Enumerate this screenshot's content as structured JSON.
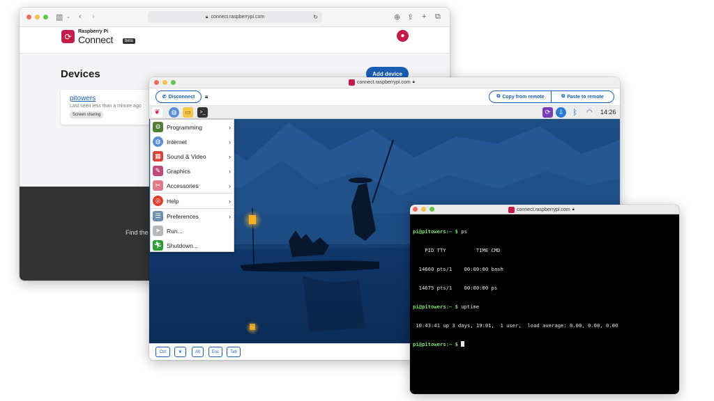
{
  "browser": {
    "url": "connect.raspberrypi.com"
  },
  "connect_page": {
    "brand_top": "Raspberry Pi",
    "brand_name": "Connect",
    "beta": "beta",
    "title": "Devices",
    "add_device": "Add device",
    "device": {
      "name": "pitowers",
      "last_seen": "Last seen less than a minute ago",
      "badge": "Screen sharing"
    },
    "footer_text": "Find the"
  },
  "remote_window": {
    "url": "connect.raspberrypi.com",
    "disconnect": "Disconnect",
    "copy_from_remote": "Copy from remote",
    "paste_to_remote": "Paste to remote",
    "clock": "14:26",
    "menu": [
      {
        "label": "Programming",
        "icon": "programming-icon",
        "submenu": true
      },
      {
        "label": "Internet",
        "icon": "globe-icon",
        "submenu": true
      },
      {
        "label": "Sound & Video",
        "icon": "sound-video-icon",
        "submenu": true
      },
      {
        "label": "Graphics",
        "icon": "graphics-icon",
        "submenu": true
      },
      {
        "label": "Accessories",
        "icon": "accessories-icon",
        "submenu": true
      },
      {
        "label": "Help",
        "icon": "lifebuoy-icon",
        "submenu": true
      },
      {
        "label": "Preferences",
        "icon": "preferences-icon",
        "submenu": true
      },
      {
        "label": "Run...",
        "icon": "run-icon",
        "submenu": false
      },
      {
        "label": "Shutdown...",
        "icon": "shutdown-icon",
        "submenu": false
      }
    ],
    "keys": [
      "Ctrl",
      "",
      "Alt",
      "Esc",
      "Tab"
    ]
  },
  "terminal": {
    "url": "connect.raspberrypi.com",
    "lines": [
      {
        "prompt": "pi@pitowers:~ $ ",
        "text": "ps"
      },
      {
        "prompt": "",
        "text": "    PID TTY          TIME CMD"
      },
      {
        "prompt": "",
        "text": "  14660 pts/1    00:00:00 bash"
      },
      {
        "prompt": "",
        "text": "  14675 pts/1    00:00:00 ps"
      },
      {
        "prompt": "pi@pitowers:~ $ ",
        "text": "uptime"
      },
      {
        "prompt": "",
        "text": " 10:43:41 up 3 days, 19:01,  1 user,  load average: 0.00, 0.00, 0.00"
      },
      {
        "prompt": "pi@pitowers:~ $ ",
        "text": ""
      }
    ]
  }
}
